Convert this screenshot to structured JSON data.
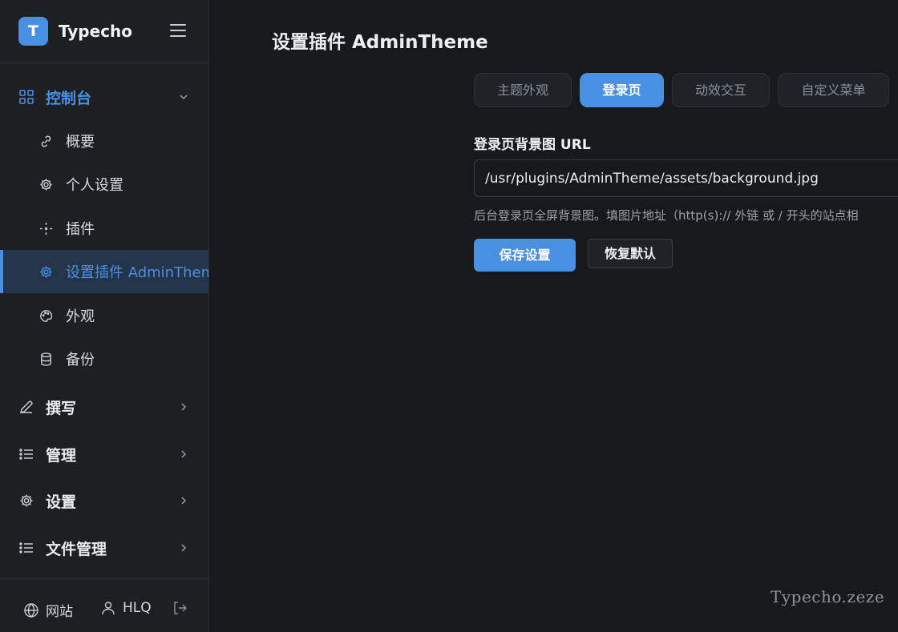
{
  "brand": {
    "logo_letter": "T",
    "name": "Typecho"
  },
  "sidebar": {
    "groups": [
      {
        "label": "控制台",
        "icon": "grid-icon",
        "expanded": true
      },
      {
        "label": "撰写",
        "icon": "pencil-icon"
      },
      {
        "label": "管理",
        "icon": "list-icon"
      },
      {
        "label": "设置",
        "icon": "gear-icon"
      },
      {
        "label": "文件管理",
        "icon": "list-icon"
      }
    ],
    "items": [
      {
        "label": "概要",
        "icon": "link-icon"
      },
      {
        "label": "个人设置",
        "icon": "gear-icon"
      },
      {
        "label": "插件",
        "icon": "plugin-icon"
      },
      {
        "label": "设置插件 AdminTheme",
        "icon": "gear-icon",
        "current": true
      },
      {
        "label": "外观",
        "icon": "palette-icon"
      },
      {
        "label": "备份",
        "icon": "database-icon"
      }
    ],
    "footer": {
      "site_label": "网站",
      "user_label": "HLQ"
    }
  },
  "main": {
    "title": "设置插件 AdminTheme",
    "tabs": [
      {
        "label": "主题外观"
      },
      {
        "label": "登录页",
        "active": true
      },
      {
        "label": "动效交互"
      },
      {
        "label": "自定义菜单"
      }
    ],
    "field": {
      "label": "登录页背景图 URL",
      "value": "/usr/plugins/AdminTheme/assets/background.jpg",
      "help": "后台登录页全屏背景图。填图片地址（http(s):// 外链 或 / 开头的站点相"
    },
    "save_label": "保存设置",
    "reset_label": "恢复默认"
  },
  "watermark": "Typecho.zeze",
  "colors": {
    "accent": "#4a90e2",
    "background": "#17191d",
    "sidebar": "#1d1f23"
  }
}
